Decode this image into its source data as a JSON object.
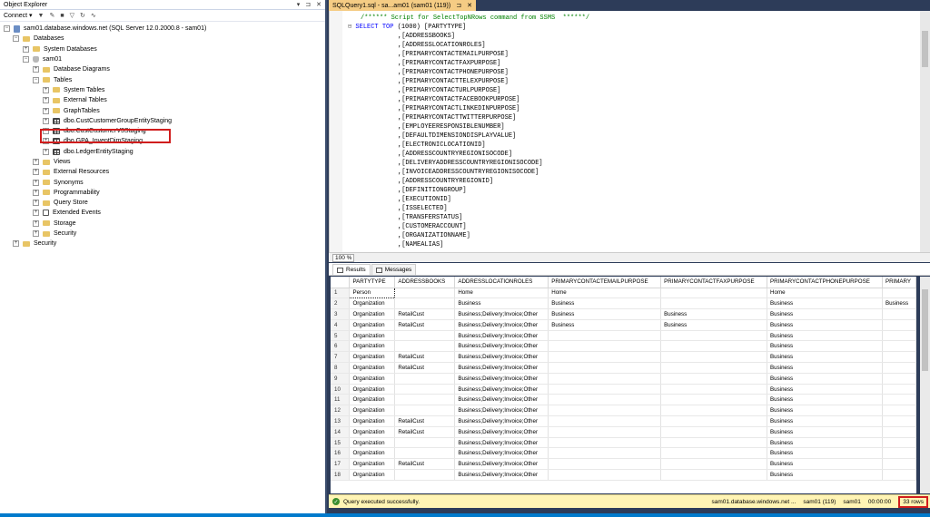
{
  "object_explorer": {
    "title": "Object Explorer",
    "pin_icons": [
      "▾",
      "⊐",
      "✕"
    ],
    "toolbar": {
      "connect": "Connect ▾",
      "icons": [
        "▼",
        "✎",
        "■",
        "▽",
        "↻",
        "∿"
      ]
    },
    "tree": [
      {
        "label": "sam01.database.windows.net (SQL Server 12.0.2000.8 - sam01)",
        "exp": "−",
        "icon": "server"
      },
      {
        "label": "Databases",
        "exp": "−",
        "icon": "folder"
      },
      {
        "label": "System Databases",
        "exp": "+",
        "icon": "folder"
      },
      {
        "label": "sam01",
        "exp": "−",
        "icon": "db"
      },
      {
        "label": "Database Diagrams",
        "exp": "+",
        "icon": "folder"
      },
      {
        "label": "Tables",
        "exp": "−",
        "icon": "folder"
      },
      {
        "label": "System Tables",
        "exp": "+",
        "icon": "folder"
      },
      {
        "label": "External Tables",
        "exp": "+",
        "icon": "folder"
      },
      {
        "label": "GraphTables",
        "exp": "+",
        "icon": "folder"
      },
      {
        "label": "dbo.CustCustomerGroupEntityStaging",
        "exp": "+",
        "icon": "table"
      },
      {
        "label": "dbo.CustCustomerV3Staging",
        "exp": "+",
        "icon": "table"
      },
      {
        "label": "dbo.GPA_InventDimStaging",
        "exp": "+",
        "icon": "table"
      },
      {
        "label": "dbo.LedgerEntityStaging",
        "exp": "+",
        "icon": "table"
      },
      {
        "label": "Views",
        "exp": "+",
        "icon": "folder"
      },
      {
        "label": "External Resources",
        "exp": "+",
        "icon": "folder"
      },
      {
        "label": "Synonyms",
        "exp": "+",
        "icon": "folder"
      },
      {
        "label": "Programmability",
        "exp": "+",
        "icon": "folder"
      },
      {
        "label": "Query Store",
        "exp": "+",
        "icon": "folder"
      },
      {
        "label": "Extended Events",
        "exp": "+",
        "icon": "evt"
      },
      {
        "label": "Storage",
        "exp": "+",
        "icon": "folder"
      },
      {
        "label": "Security",
        "exp": "+",
        "icon": "folder"
      },
      {
        "label": "Security",
        "exp": "+",
        "icon": "folder"
      }
    ]
  },
  "editor": {
    "tab_label": "SQLQuery1.sql - sa...am01 (sam01 (119))",
    "tab_icons": [
      "⊐",
      "✕"
    ],
    "comment": "/****** Script for SelectTopNRows command from SSMS  ******/",
    "select_keyword": "SELECT TOP",
    "select_rest": " (1000) [PARTYTYPE]",
    "columns": [
      ",[ADDRESSBOOKS]",
      ",[ADDRESSLOCATIONROLES]",
      ",[PRIMARYCONTACTEMAILPURPOSE]",
      ",[PRIMARYCONTACTFAXPURPOSE]",
      ",[PRIMARYCONTACTPHONEPURPOSE]",
      ",[PRIMARYCONTACTTELEXPURPOSE]",
      ",[PRIMARYCONTACTURLPURPOSE]",
      ",[PRIMARYCONTACTFACEBOOKPURPOSE]",
      ",[PRIMARYCONTACTLINKEDINPURPOSE]",
      ",[PRIMARYCONTACTTWITTERPURPOSE]",
      ",[EMPLOYEERESPONSIBLENUMBER]",
      ",[DEFAULTDIMENSIONDISPLAYVALUE]",
      ",[ELECTRONICLOCATIONID]",
      ",[ADDRESSCOUNTRYREGIONISOCODE]",
      ",[DELIVERYADDRESSCOUNTRYREGIONISOCODE]",
      ",[INVOICEADDRESSCOUNTRYREGIONISOCODE]",
      ",[ADDRESSCOUNTRYREGIONID]",
      ",[DEFINITIONGROUP]",
      ",[EXECUTIONID]",
      ",[ISSELECTED]",
      ",[TRANSFERSTATUS]",
      ",[CUSTOMERACCOUNT]",
      ",[ORGANIZATIONNAME]",
      ",[NAMEALIAS]"
    ],
    "zoom": "100 %"
  },
  "results": {
    "tabs": [
      {
        "label": "Results"
      },
      {
        "label": "Messages"
      }
    ],
    "headers": [
      "",
      "PARTYTYPE",
      "ADDRESSBOOKS",
      "ADDRESSLOCATIONROLES",
      "PRIMARYCONTACTEMAILPURPOSE",
      "PRIMARYCONTACTFAXPURPOSE",
      "PRIMARYCONTACTPHONEPURPOSE",
      "PRIMARY"
    ],
    "rows": [
      [
        "1",
        "Person",
        "",
        "Home",
        "Home",
        "",
        "Home",
        ""
      ],
      [
        "2",
        "Organization",
        "",
        "Business",
        "Business",
        "",
        "Business",
        "Business"
      ],
      [
        "3",
        "Organization",
        "RetailCust",
        "Business;Delivery;Invoice;Other",
        "Business",
        "Business",
        "Business",
        ""
      ],
      [
        "4",
        "Organization",
        "RetailCust",
        "Business;Delivery;Invoice;Other",
        "Business",
        "Business",
        "Business",
        ""
      ],
      [
        "5",
        "Organization",
        "",
        "Business;Delivery;Invoice;Other",
        "",
        "",
        "Business",
        ""
      ],
      [
        "6",
        "Organization",
        "",
        "Business;Delivery;Invoice;Other",
        "",
        "",
        "Business",
        ""
      ],
      [
        "7",
        "Organization",
        "RetailCust",
        "Business;Delivery;Invoice;Other",
        "",
        "",
        "Business",
        ""
      ],
      [
        "8",
        "Organization",
        "RetailCust",
        "Business;Delivery;Invoice;Other",
        "",
        "",
        "Business",
        ""
      ],
      [
        "9",
        "Organization",
        "",
        "Business;Delivery;Invoice;Other",
        "",
        "",
        "Business",
        ""
      ],
      [
        "10",
        "Organization",
        "",
        "Business;Delivery;Invoice;Other",
        "",
        "",
        "Business",
        ""
      ],
      [
        "11",
        "Organization",
        "",
        "Business;Delivery;Invoice;Other",
        "",
        "",
        "Business",
        ""
      ],
      [
        "12",
        "Organization",
        "",
        "Business;Delivery;Invoice;Other",
        "",
        "",
        "Business",
        ""
      ],
      [
        "13",
        "Organization",
        "RetailCust",
        "Business;Delivery;Invoice;Other",
        "",
        "",
        "Business",
        ""
      ],
      [
        "14",
        "Organization",
        "RetailCust",
        "Business;Delivery;Invoice;Other",
        "",
        "",
        "Business",
        ""
      ],
      [
        "15",
        "Organization",
        "",
        "Business;Delivery;Invoice;Other",
        "",
        "",
        "Business",
        ""
      ],
      [
        "16",
        "Organization",
        "",
        "Business;Delivery;Invoice;Other",
        "",
        "",
        "Business",
        ""
      ],
      [
        "17",
        "Organization",
        "RetailCust",
        "Business;Delivery;Invoice;Other",
        "",
        "",
        "Business",
        ""
      ],
      [
        "18",
        "Organization",
        "",
        "Business;Delivery;Invoice;Other",
        "",
        "",
        "Business",
        ""
      ]
    ]
  },
  "status": {
    "message": "Query executed successfully.",
    "server": "sam01.database.windows.net ...",
    "session": "sam01 (119)",
    "database": "sam01",
    "elapsed": "00:00:00",
    "rows": "33 rows"
  },
  "colors": {
    "accent_tab": "#f5cc84",
    "status_bg": "#fff4b4",
    "highlight": "#d01d1d",
    "chrome": "#2d3c59"
  }
}
